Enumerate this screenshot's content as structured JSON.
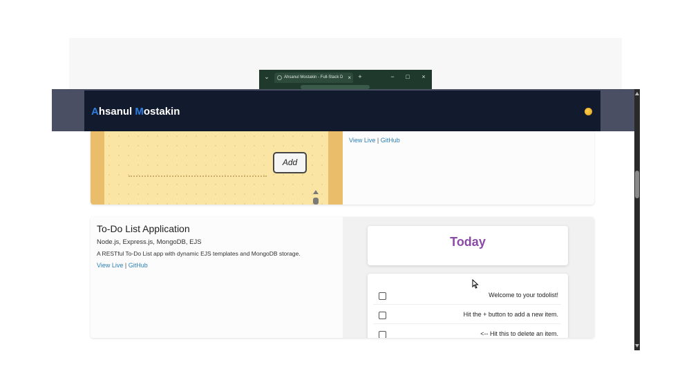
{
  "chrome": {
    "tab_title": "Ahsanul Mostakin - Full-Stack D",
    "tab_close": "×",
    "new_tab": "+",
    "minimize": "−",
    "maximize": "□",
    "close": "×"
  },
  "navbar": {
    "brand_first_initial": "A",
    "brand_first_rest": "hsanul ",
    "brand_last_initial": "M",
    "brand_last_rest": "ostakin",
    "brand_highlight_color": "#2f7de0"
  },
  "card1": {
    "add_button_label": "Add",
    "view_live": "View Live",
    "separator": " | ",
    "github": "GitHub"
  },
  "card2": {
    "title": "To-Do List Application",
    "tech": "Node.js, Express.js, MongoDB, EJS",
    "description": "A RESTful To-Do List app with dynamic EJS templates and MongoDB storage.",
    "view_live": "View Live",
    "separator": " | ",
    "github": "GitHub",
    "preview": {
      "heading": "Today",
      "items": [
        "Welcome to your todolist!",
        "Hit the + button to add a new item.",
        "<-- Hit this to delete an item."
      ]
    }
  }
}
